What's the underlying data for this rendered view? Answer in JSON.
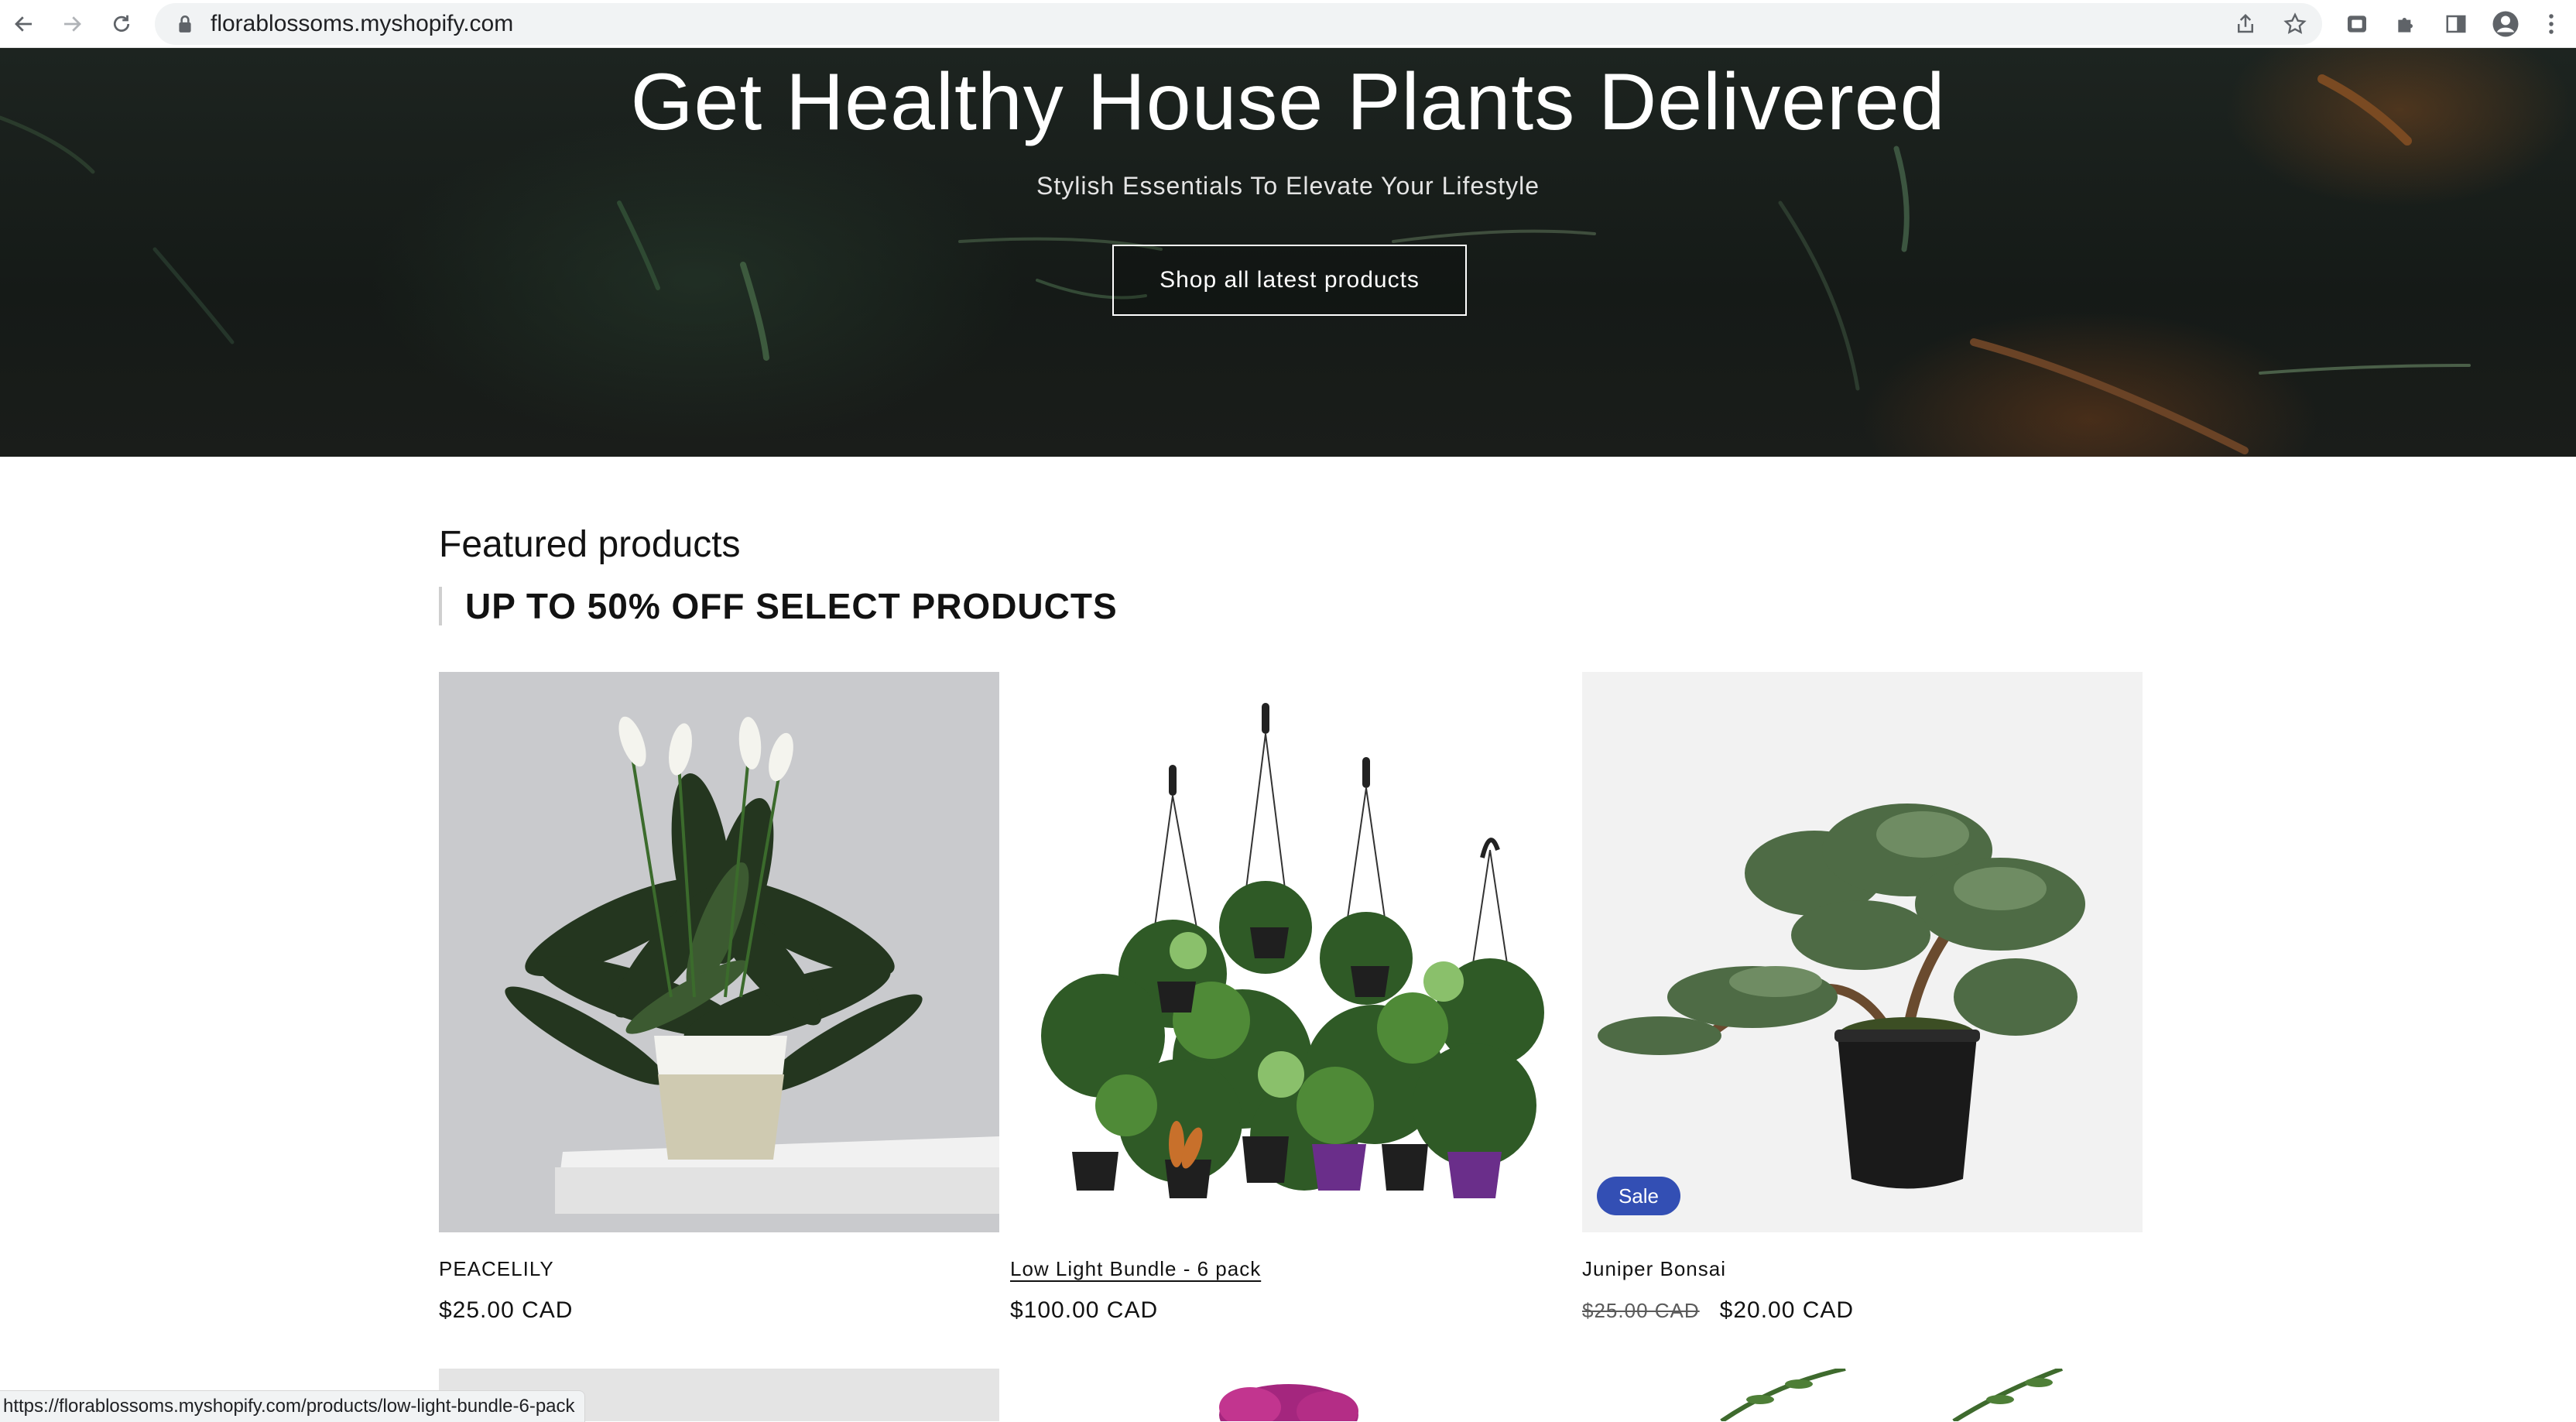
{
  "browser": {
    "url": "florablossoms.myshopify.com",
    "status_url": "https://florablossoms.myshopify.com/products/low-light-bundle-6-pack"
  },
  "hero": {
    "title": "Get Healthy House Plants Delivered",
    "subtitle": "Stylish Essentials To Elevate Your Lifestyle",
    "button": "Shop all latest products"
  },
  "featured": {
    "heading": "Featured products",
    "promo": "UP TO 50% OFF SELECT PRODUCTS",
    "products": [
      {
        "name": "PEACELILY",
        "price": "$25.00 CAD"
      },
      {
        "name": "Low Light Bundle - 6 pack",
        "price": "$100.00 CAD"
      },
      {
        "name": "Juniper Bonsai",
        "old_price": "$25.00 CAD",
        "price": "$20.00 CAD",
        "badge": "Sale"
      }
    ]
  },
  "colors": {
    "sale_badge": "#334fb4",
    "hero_bg": "#1a1f1c"
  }
}
